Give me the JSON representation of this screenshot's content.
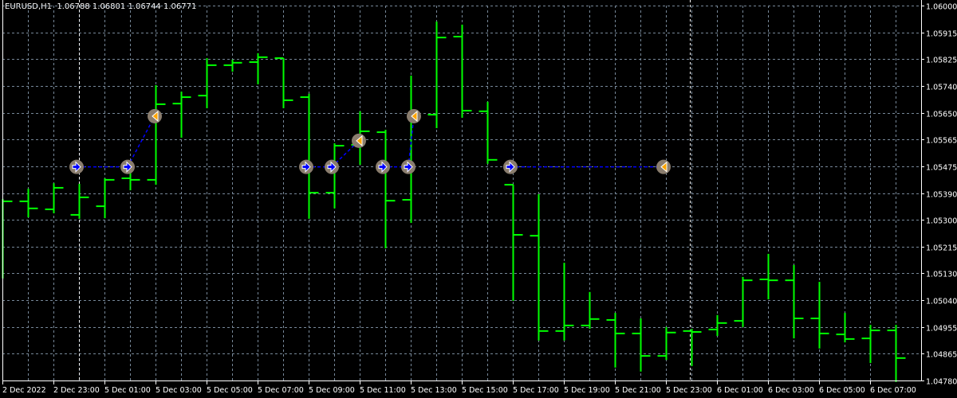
{
  "header": {
    "symbol": "EURUSD,H1",
    "ohlc": "1.06788 1.06801 1.06744 1.06771"
  },
  "colors": {
    "background": "#000000",
    "bar": "#00ff00",
    "grid": "#778899",
    "axis": "#ffffff",
    "trade_line": "#0000ff",
    "marker_circle": "#8a7d6e",
    "buy_arrow": "#0000ff",
    "sell_arrow": "#ffa500"
  },
  "chart_data": {
    "type": "ohlc",
    "title": "EURUSD,H1",
    "ylim": [
      1.0478,
      1.06
    ],
    "grid": true,
    "y_ticks": [
      "1.06000",
      "1.05915",
      "1.05825",
      "1.05740",
      "1.05650",
      "1.05565",
      "1.05475",
      "1.05390",
      "1.05300",
      "1.05215",
      "1.05130",
      "1.05040",
      "1.04955",
      "1.04865",
      "1.04780"
    ],
    "x_ticks": [
      "2 Dec 2022",
      "2 Dec 23:00",
      "5 Dec 01:00",
      "5 Dec 03:00",
      "5 Dec 05:00",
      "5 Dec 07:00",
      "5 Dec 09:00",
      "5 Dec 11:00",
      "5 Dec 13:00",
      "5 Dec 15:00",
      "5 Dec 17:00",
      "5 Dec 19:00",
      "5 Dec 21:00",
      "5 Dec 23:00",
      "6 Dec 01:00",
      "6 Dec 03:00",
      "6 Dec 05:00",
      "6 Dec 07:00"
    ],
    "bars": [
      {
        "o": 1.05363,
        "h": 1.05371,
        "l": 1.05112,
        "c": 1.05363
      },
      {
        "o": 1.05363,
        "h": 1.05404,
        "l": 1.05311,
        "c": 1.0534
      },
      {
        "o": 1.05337,
        "h": 1.05422,
        "l": 1.05324,
        "c": 1.05407
      },
      {
        "o": 1.05319,
        "h": 1.0542,
        "l": 1.05306,
        "c": 1.05376
      },
      {
        "o": 1.05347,
        "h": 1.05438,
        "l": 1.05308,
        "c": 1.05433
      },
      {
        "o": 1.05438,
        "h": 1.05474,
        "l": 1.05399,
        "c": 1.05433
      },
      {
        "o": 1.05433,
        "h": 1.05741,
        "l": 1.05417,
        "c": 1.05679
      },
      {
        "o": 1.05681,
        "h": 1.0572,
        "l": 1.0557,
        "c": 1.05702
      },
      {
        "o": 1.05707,
        "h": 1.05829,
        "l": 1.05666,
        "c": 1.05806
      },
      {
        "o": 1.05806,
        "h": 1.05824,
        "l": 1.05785,
        "c": 1.05814
      },
      {
        "o": 1.05816,
        "h": 1.05845,
        "l": 1.05744,
        "c": 1.05832
      },
      {
        "o": 1.05829,
        "h": 1.05829,
        "l": 1.05666,
        "c": 1.05692
      },
      {
        "o": 1.05702,
        "h": 1.05713,
        "l": 1.05306,
        "c": 1.05391
      },
      {
        "o": 1.05391,
        "h": 1.05552,
        "l": 1.0534,
        "c": 1.05544
      },
      {
        "o": 1.05547,
        "h": 1.05656,
        "l": 1.05482,
        "c": 1.05591
      },
      {
        "o": 1.05588,
        "h": 1.05596,
        "l": 1.0521,
        "c": 1.05365
      },
      {
        "o": 1.05368,
        "h": 1.05772,
        "l": 1.05293,
        "c": 1.05645
      },
      {
        "o": 1.05645,
        "h": 1.05948,
        "l": 1.05601,
        "c": 1.05896
      },
      {
        "o": 1.05899,
        "h": 1.05938,
        "l": 1.05635,
        "c": 1.05658
      },
      {
        "o": 1.05656,
        "h": 1.05687,
        "l": 1.05485,
        "c": 1.05498
      },
      {
        "o": 1.05417,
        "h": 1.05417,
        "l": 1.05039,
        "c": 1.05254
      },
      {
        "o": 1.05251,
        "h": 1.05386,
        "l": 1.0491,
        "c": 1.04941
      },
      {
        "o": 1.04941,
        "h": 1.05163,
        "l": 1.0491,
        "c": 1.04959
      },
      {
        "o": 1.04959,
        "h": 1.05068,
        "l": 1.04948,
        "c": 1.0498
      },
      {
        "o": 1.04977,
        "h": 1.05,
        "l": 1.04822,
        "c": 1.04933
      },
      {
        "o": 1.04933,
        "h": 1.04982,
        "l": 1.04809,
        "c": 1.0486
      },
      {
        "o": 1.0486,
        "h": 1.04954,
        "l": 1.04847,
        "c": 1.04936
      },
      {
        "o": 1.04941,
        "h": 1.04948,
        "l": 1.04827,
        "c": 1.04938
      },
      {
        "o": 1.04946,
        "h": 1.04993,
        "l": 1.04925,
        "c": 1.04967
      },
      {
        "o": 1.04974,
        "h": 1.05117,
        "l": 1.04954,
        "c": 1.05106
      },
      {
        "o": 1.05109,
        "h": 1.05192,
        "l": 1.05044,
        "c": 1.05106
      },
      {
        "o": 1.05106,
        "h": 1.05156,
        "l": 1.04917,
        "c": 1.04982
      },
      {
        "o": 1.04982,
        "h": 1.05101,
        "l": 1.04884,
        "c": 1.04933
      },
      {
        "o": 1.0493,
        "h": 1.05,
        "l": 1.04904,
        "c": 1.04915
      },
      {
        "o": 1.04917,
        "h": 1.04961,
        "l": 1.04837,
        "c": 1.04943
      },
      {
        "o": 1.04943,
        "h": 1.04961,
        "l": 1.04775,
        "c": 1.04853
      }
    ],
    "trades": [
      {
        "entry_bar": 3,
        "entry_price": 1.05475,
        "exit_bar": 5,
        "exit_price": 1.05475
      },
      {
        "entry_bar": 5,
        "entry_price": 1.05475,
        "exit_bar": 6,
        "exit_price": 1.0564
      },
      {
        "entry_bar": 12,
        "entry_price": 1.05475,
        "exit_bar": 13,
        "exit_price": 1.05475
      },
      {
        "entry_bar": 13,
        "entry_price": 1.05475,
        "exit_bar": 14,
        "exit_price": 1.0556
      },
      {
        "entry_bar": 15,
        "entry_price": 1.05475,
        "exit_bar": 16,
        "exit_price": 1.05475
      },
      {
        "entry_bar": 16,
        "entry_price": 1.05475,
        "exit_bar": 16,
        "exit_price": 1.0564
      },
      {
        "entry_bar": 20,
        "entry_price": 1.05475,
        "exit_bar": 26,
        "exit_price": 1.05475
      }
    ],
    "period_separators": [
      "2 Dec 23:00",
      "6 Dec 00:00"
    ]
  }
}
